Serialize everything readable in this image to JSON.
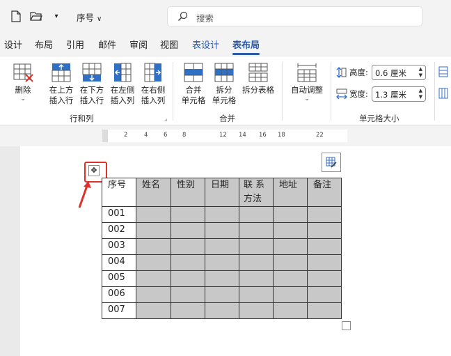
{
  "titlebar": {
    "new_icon": "new-document-icon",
    "open_icon": "open-folder-icon",
    "customize_icon": "customize-toolbar-icon",
    "document_title": "序号",
    "search_placeholder": "搜索"
  },
  "tabs": [
    "设计",
    "布局",
    "引用",
    "邮件",
    "审阅",
    "视图",
    "表设计",
    "表布局"
  ],
  "ribbon": {
    "delete_label": "删除",
    "insert_above": [
      "在上方",
      "插入行"
    ],
    "insert_below": [
      "在下方",
      "插入行"
    ],
    "insert_left": [
      "在左侧",
      "插入列"
    ],
    "insert_right": [
      "在右侧",
      "插入列"
    ],
    "group_rows_cols": "行和列",
    "merge_cells": [
      "合并",
      "单元格"
    ],
    "split_cells": [
      "拆分",
      "单元格"
    ],
    "split_table": "拆分表格",
    "group_merge": "合并",
    "autofit": "自动调整",
    "height_label": "高度:",
    "height_value": "0.6 厘米",
    "width_label": "宽度:",
    "width_value": "1.3 厘米",
    "group_cell_size": "单元格大小"
  },
  "ruler": {
    "labels": [
      "2",
      "4",
      "6",
      "8",
      "12",
      "14",
      "16",
      "18",
      "22"
    ]
  },
  "table": {
    "headers": [
      "序号",
      "姓名",
      "性别",
      "日期",
      "联系方法",
      "地址",
      "备注"
    ],
    "contact_line1": "联 系",
    "contact_line2": "方法",
    "rows": [
      "001",
      "002",
      "003",
      "004",
      "005",
      "006",
      "007"
    ]
  },
  "colors": {
    "accent": "#2a5aa8",
    "highlight": "#e0302a",
    "cell_shading": "#c8c8c8"
  }
}
